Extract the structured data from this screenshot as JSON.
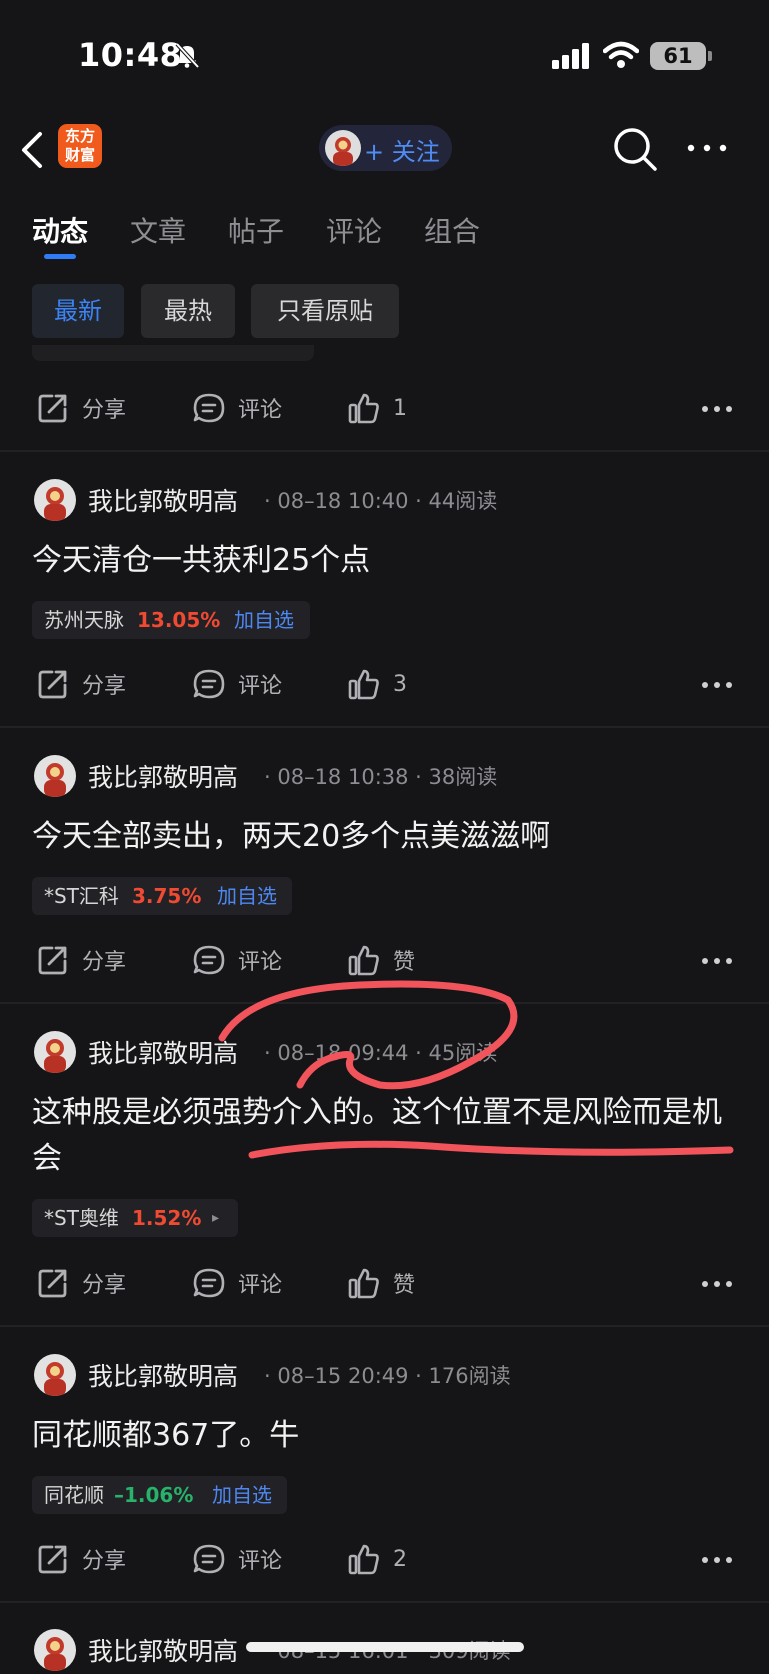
{
  "status_bar": {
    "time": "10:48",
    "battery": "61"
  },
  "nav": {
    "logo_line1": "东方",
    "logo_line2": "财富",
    "follow_label": "+ 关注"
  },
  "tabs": [
    {
      "label": "动态",
      "active": true
    },
    {
      "label": "文章",
      "active": false
    },
    {
      "label": "帖子",
      "active": false
    },
    {
      "label": "评论",
      "active": false
    },
    {
      "label": "组合",
      "active": false
    }
  ],
  "filters": [
    {
      "label": "最新",
      "active": true
    },
    {
      "label": "最热",
      "active": false
    },
    {
      "label": "只看原贴",
      "active": false
    }
  ],
  "actions": {
    "share": "分享",
    "comment": "评论",
    "like_default": "赞"
  },
  "top_actions": {
    "likes": "1"
  },
  "posts": [
    {
      "author": "我比郭敬明高",
      "meta": "· 08–18 10:40 · 44阅读",
      "text": "今天清仓一共获利25个点",
      "stock": {
        "name": "苏州天脉",
        "pct": "13.05%",
        "dir": "up",
        "add": "加自选"
      },
      "likes": "3"
    },
    {
      "author": "我比郭敬明高",
      "meta": "· 08–18 10:38 · 38阅读",
      "text": "今天全部卖出，两天20多个点美滋滋啊",
      "stock": {
        "name": "*ST汇科",
        "pct": "3.75%",
        "dir": "up",
        "add": "加自选"
      },
      "likes": "赞"
    },
    {
      "author": "我比郭敬明高",
      "meta": "· 08–18 09:44 · 45阅读",
      "text": "这种股是必须强势介入的。这个位置不是风险而是机会",
      "stock": {
        "name": "*ST奥维",
        "pct": "1.52%",
        "dir": "up",
        "add": "▸"
      },
      "likes": "赞"
    },
    {
      "author": "我比郭敬明高",
      "meta": "· 08–15 20:49 · 176阅读",
      "text": "同花顺都367了。牛",
      "stock": {
        "name": "同花顺",
        "pct": "–1.06%",
        "dir": "down",
        "add": "加自选"
      },
      "likes": "2"
    },
    {
      "author": "我比郭敬明高",
      "meta": "· 08–15 16:01 · 309阅读"
    }
  ],
  "colors": {
    "up": "#f04a32",
    "down": "#27b36a",
    "accent": "#2f7cf6",
    "annotation": "#f2545b"
  }
}
